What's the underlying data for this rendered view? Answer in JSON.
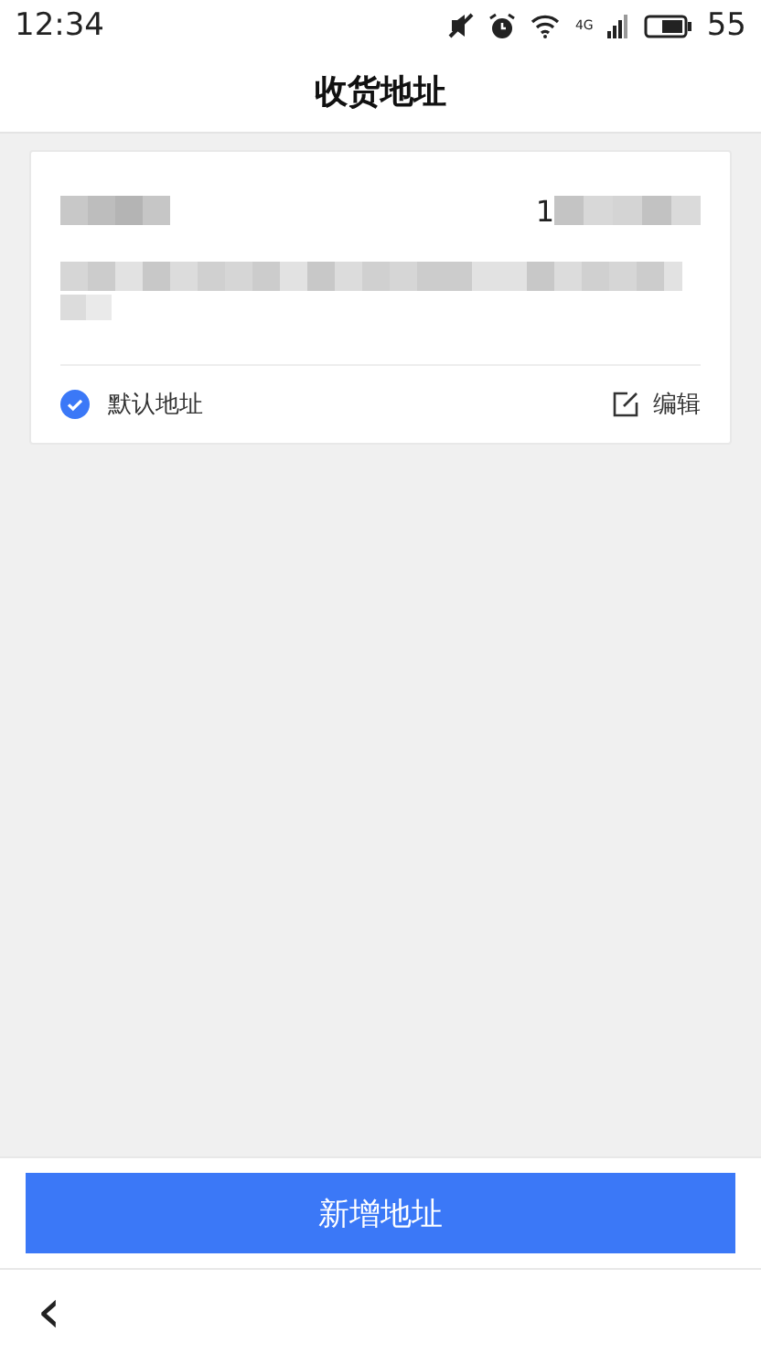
{
  "status_bar": {
    "time": "12:34",
    "battery": "55",
    "network": "4G"
  },
  "header": {
    "title": "收货地址"
  },
  "addresses": [
    {
      "phone": "1",
      "is_default": true,
      "default_label": "默认地址",
      "edit_label": "编辑"
    }
  ],
  "add_button": {
    "label": "新增地址"
  },
  "nav_bar": {
    "back": "‹"
  }
}
